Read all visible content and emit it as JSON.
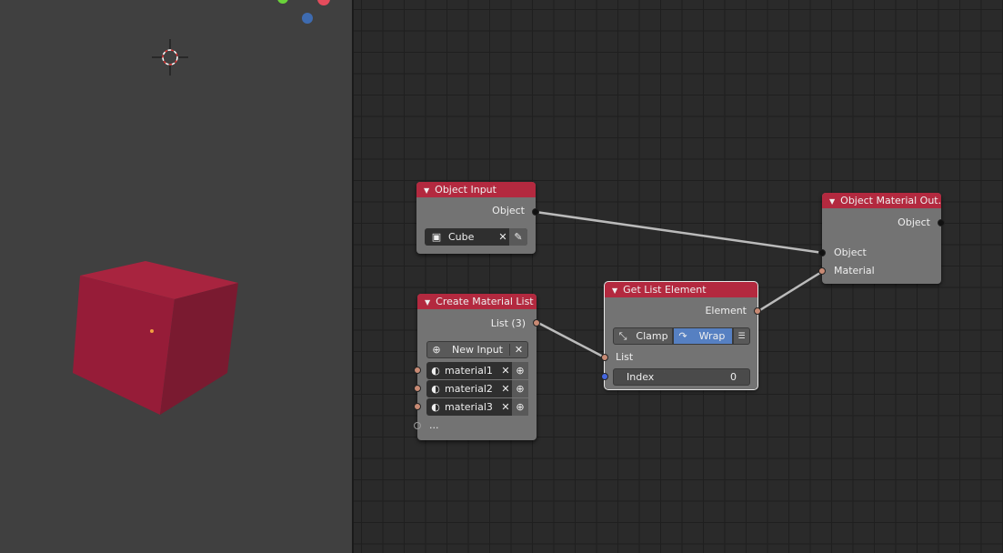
{
  "nodes": {
    "object_input": {
      "title": "Object Input",
      "output": "Object",
      "object_value": "Cube"
    },
    "object_material_output": {
      "title": "Object Material Out...",
      "output": "Object",
      "inputs": [
        "Object",
        "Material"
      ]
    },
    "create_material_list": {
      "title": "Create Material List",
      "output": "List (3)",
      "new_input": "New Input",
      "materials": [
        "material1",
        "material2",
        "material3"
      ],
      "more": "..."
    },
    "get_list_element": {
      "title": "Get List Element",
      "output": "Element",
      "modes": [
        "Clamp",
        "Wrap"
      ],
      "active_mode": "Wrap",
      "input_list": "List",
      "index_label": "Index",
      "index_value": "0"
    }
  },
  "colors": {
    "header": "#b3293f",
    "node": "#737373",
    "wrap_active": "#5680c2",
    "socket_object": "#111111",
    "socket_material": "#c88a74",
    "socket_int": "#4466dd",
    "cube": "#9e1f3d"
  }
}
